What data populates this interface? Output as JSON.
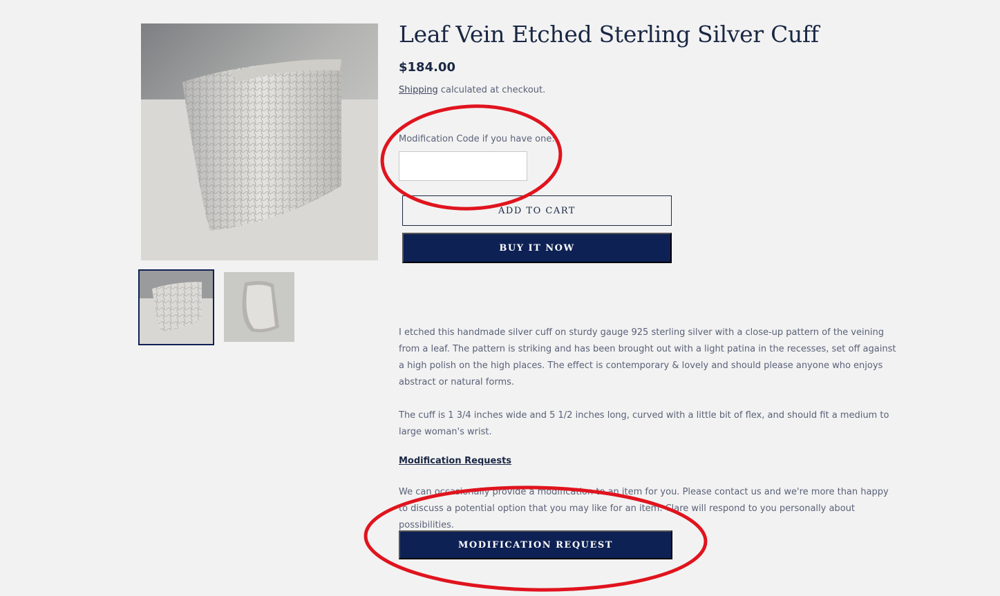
{
  "product": {
    "title": "Leaf Vein Etched Sterling Silver Cuff",
    "price": "$184.00",
    "shipping_link": "Shipping",
    "shipping_suffix": " calculated at checkout."
  },
  "form": {
    "modification_label": "Modification Code if you have one:",
    "modification_value": "",
    "add_to_cart_label": "ADD TO CART",
    "buy_now_label": "BUY IT NOW"
  },
  "description": {
    "paragraph_1": "I etched this handmade silver cuff on sturdy gauge 925 sterling silver with a close-up pattern of the veining from a leaf. The pattern is striking and has been brought out with a light patina in the recesses, set off against a high polish on the high places. The effect is contemporary & lovely and should please anyone who enjoys abstract or natural forms.",
    "paragraph_2": "The cuff is 1 3/4 inches wide and 5 1/2 inches long, curved with a little bit of flex, and should fit a medium to large woman's wrist.",
    "modification_heading": "Modification Requests",
    "paragraph_3": "We can occasionally provide a modification to an item for you. Please contact us and we're more than happy to discuss a potential option that you may like for an item. Clare will respond to you personally about possibilities.",
    "modification_request_label": "MODIFICATION REQUEST"
  },
  "colors": {
    "brand_navy": "#0e2154",
    "annotation_red": "#e0141e",
    "background": "#f2f2f2"
  }
}
